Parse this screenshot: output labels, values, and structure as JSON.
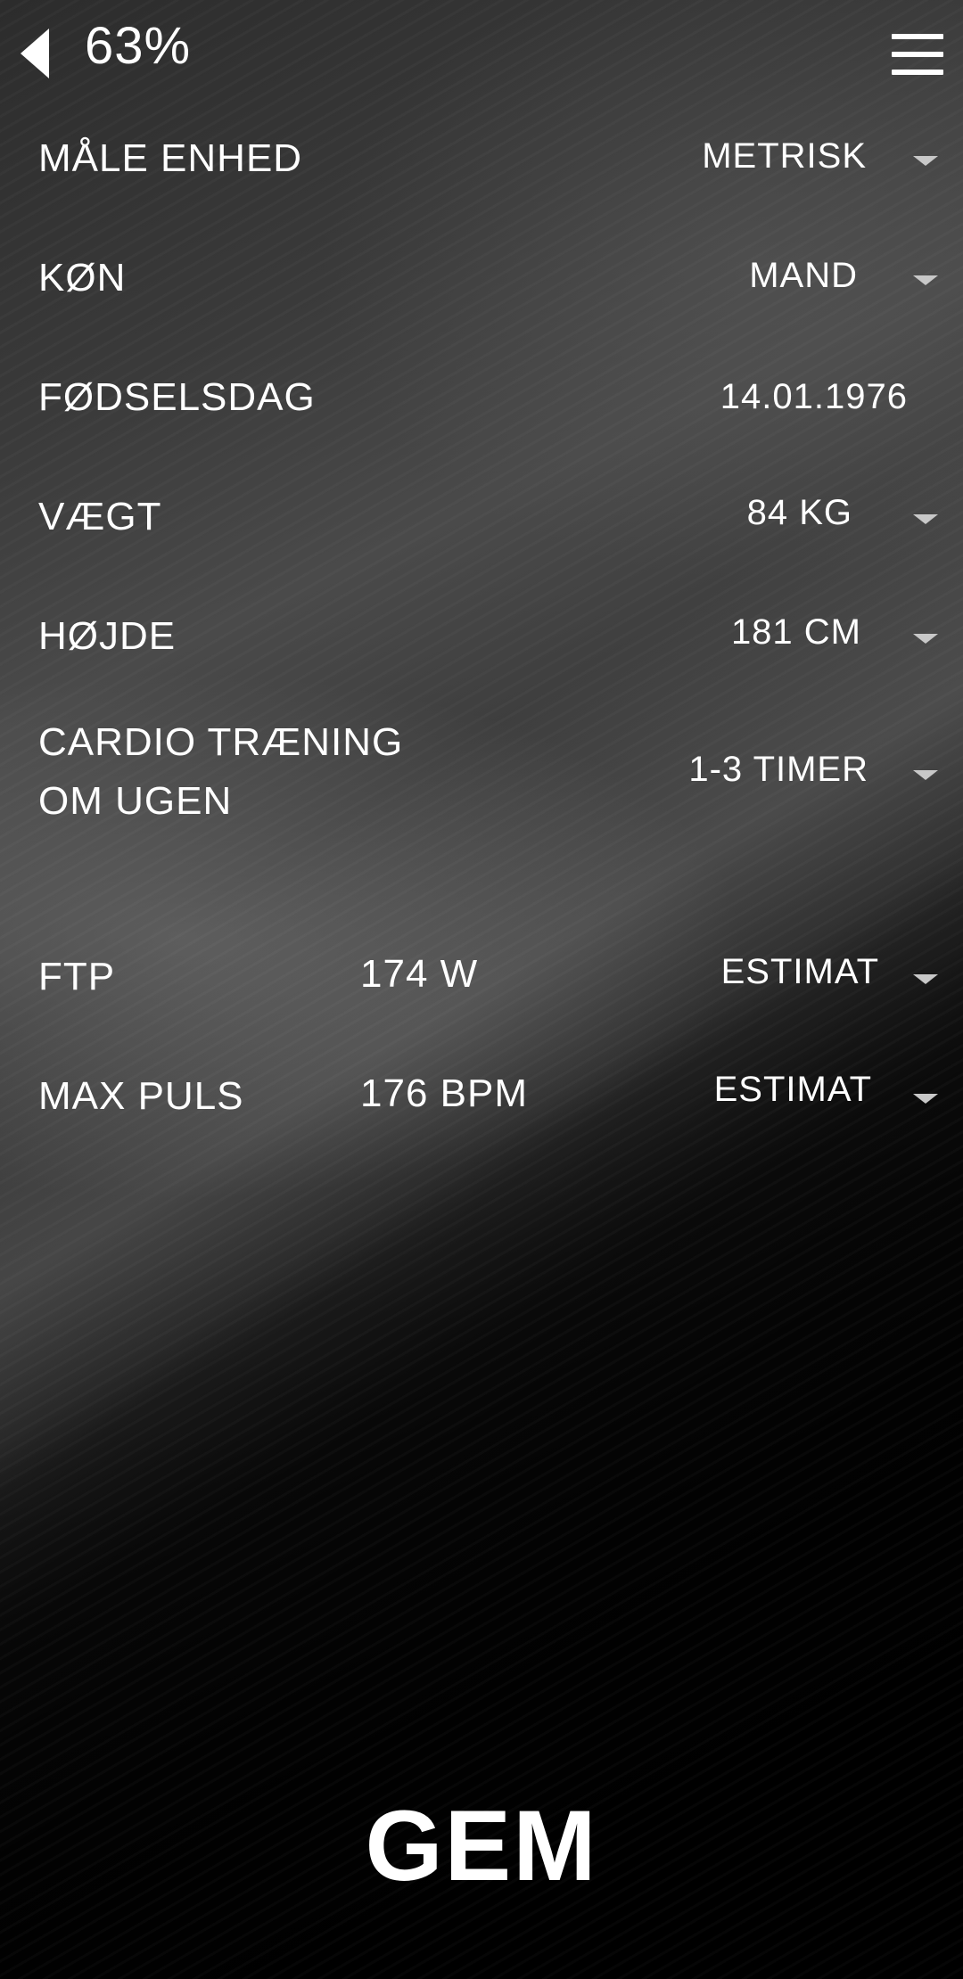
{
  "header": {
    "progress": "63%",
    "back_icon": "back-triangle-icon",
    "menu_icon": "hamburger-menu-icon"
  },
  "fields": {
    "unit": {
      "label": "MÅLE ENHED",
      "value": "METRISK"
    },
    "gender": {
      "label": "KØN",
      "value": "MAND"
    },
    "birthday": {
      "label": "FØDSELSDAG",
      "value": "14.01.1976"
    },
    "weight": {
      "label": "VÆGT",
      "value": "84 KG"
    },
    "height": {
      "label": "HØJDE",
      "value": "181 CM"
    },
    "cardio": {
      "label_line1": "CARDIO TRÆNING",
      "label_line2": "OM UGEN",
      "value": "1-3 TIMER"
    },
    "ftp": {
      "label": "FTP",
      "reading": "174 W",
      "value": "ESTIMAT"
    },
    "max_pulse": {
      "label": "MAX PULS",
      "reading": "176 BPM",
      "value": "ESTIMAT"
    }
  },
  "save_label": "GEM",
  "colors": {
    "text": "#ffffff",
    "caret": "#c8c8c8",
    "background": "#000000"
  }
}
